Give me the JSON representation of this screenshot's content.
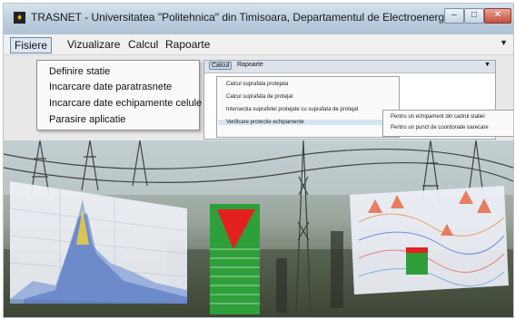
{
  "window": {
    "title": "TRASNET - Universitatea \"Politehnica\" din Timisoara, Departamentul de Electroenergetica"
  },
  "menubar": {
    "items": [
      "Fisiere",
      "Vizualizare",
      "Calcul",
      "Rapoarte"
    ]
  },
  "file_menu": {
    "items": [
      "Definire statie",
      "Incarcare date paratrasnete",
      "Incarcare date echipamente celule",
      "Parasire aplicatie"
    ]
  },
  "inner_window": {
    "menubar": [
      "Calcul",
      "Rapoarte"
    ],
    "calcul_menu": [
      "Calcul suprafata protejata",
      "Calcul suprafata de protejat",
      "Intersectia suprafetei protejate cu suprafata de protejat",
      "Verificare protectie echipamente"
    ],
    "submenu": [
      "Pentru un echipament din cadrul statiei",
      "Pentru un punct de coordonate oarecare"
    ]
  },
  "colors": {
    "title_bar": "#b9cbdc",
    "menu_highlight": "#dbe6f1",
    "red_marker": "#e32020",
    "green_block": "#2f9f3a"
  },
  "icons": {
    "app": "app-icon",
    "minimize": "minimize-icon",
    "maximize": "maximize-icon",
    "close": "close-icon"
  }
}
